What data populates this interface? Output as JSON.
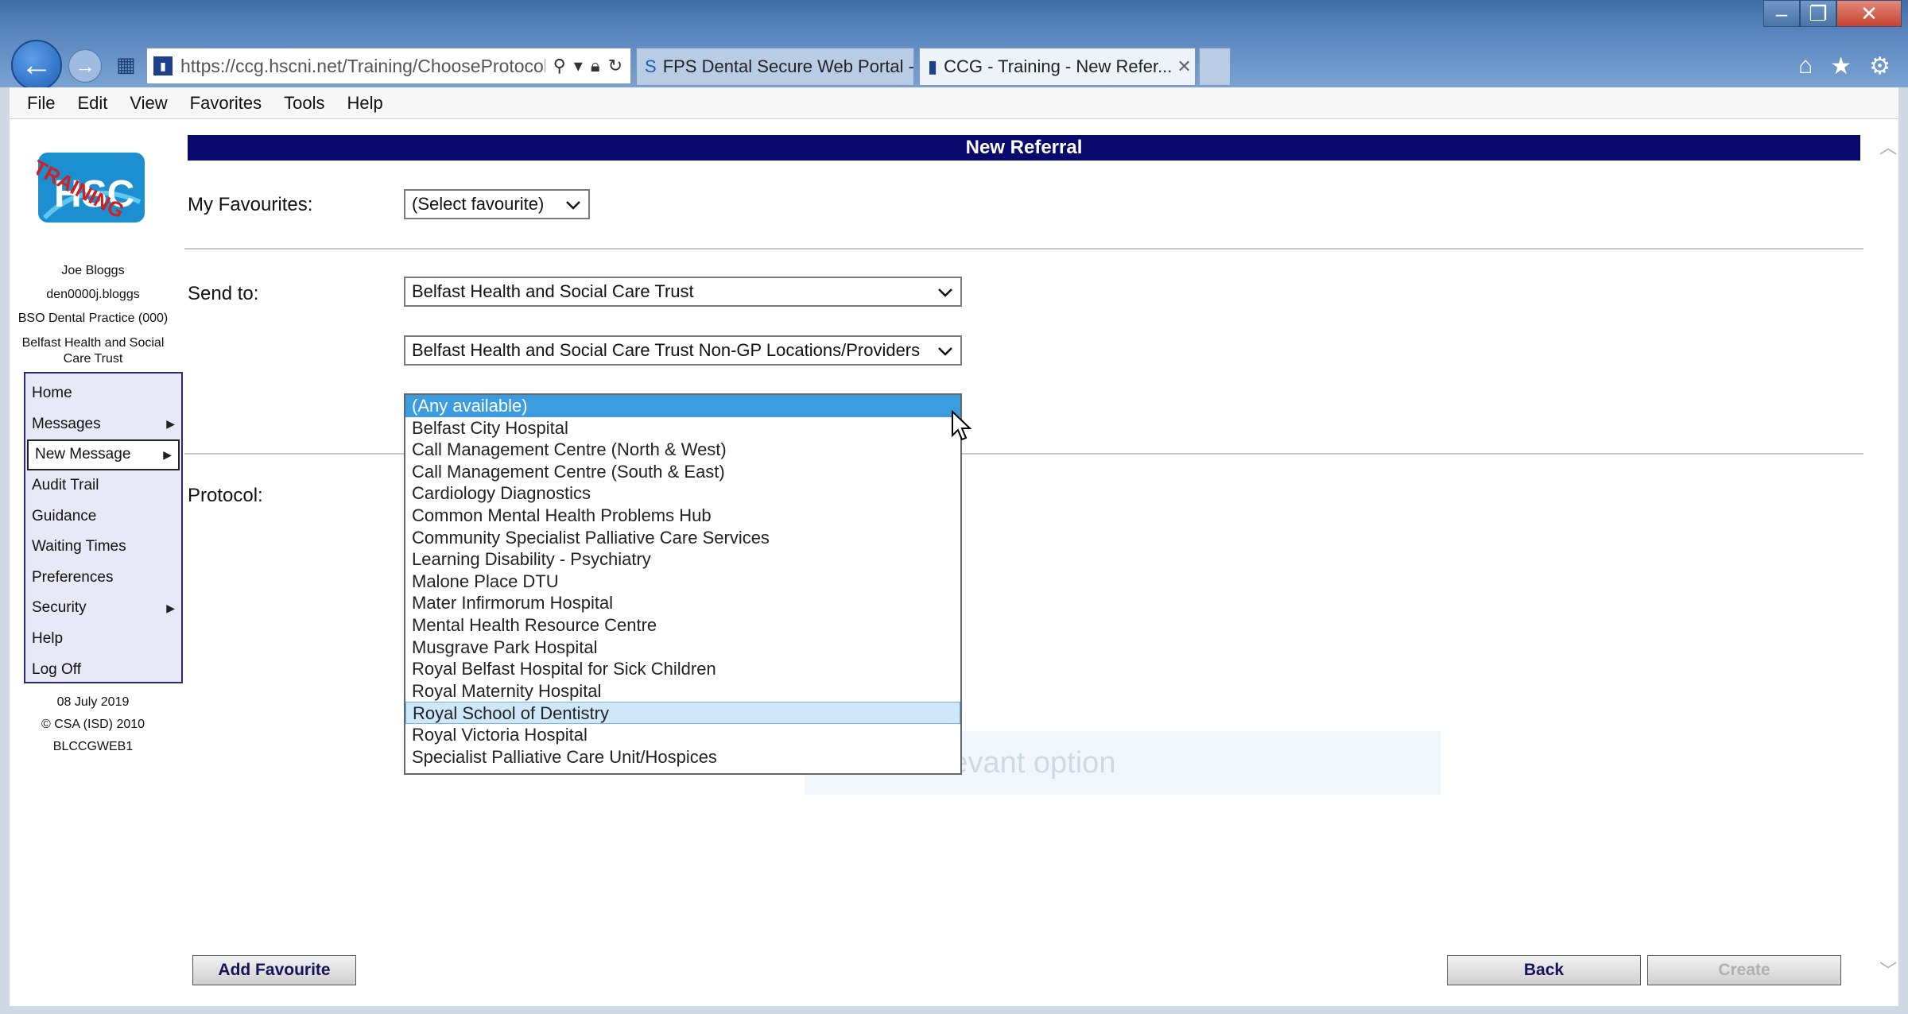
{
  "browser": {
    "address_url": "https://ccg.hscni.net/Training/ChooseProtocol",
    "tabs": [
      {
        "label": "FPS Dental Secure Web Portal -..."
      },
      {
        "label": "CCG - Training - New Refer..."
      }
    ],
    "menu": [
      "File",
      "Edit",
      "View",
      "Favorites",
      "Tools",
      "Help"
    ]
  },
  "sidebar": {
    "logo_text": "HSC",
    "logo_overlay": "TRAINING",
    "user_name": "Joe Bloggs",
    "user_id": "den0000j.bloggs",
    "practice": "BSO Dental Practice (000)",
    "trust": "Belfast Health and Social Care Trust",
    "menu": [
      {
        "label": "Home",
        "has_submenu": false
      },
      {
        "label": "Messages",
        "has_submenu": true
      },
      {
        "label": "New Message",
        "has_submenu": true
      },
      {
        "label": "Audit Trail",
        "has_submenu": false
      },
      {
        "label": "Guidance",
        "has_submenu": false
      },
      {
        "label": "Waiting Times",
        "has_submenu": false
      },
      {
        "label": "Preferences",
        "has_submenu": false
      },
      {
        "label": "Security",
        "has_submenu": true
      },
      {
        "label": "Help",
        "has_submenu": false
      },
      {
        "label": "Log Off",
        "has_submenu": false
      }
    ],
    "date": "08 July 2019",
    "copyright": "© CSA (ISD) 2010",
    "server": "BLCCGWEB1"
  },
  "form": {
    "title": "New Referral",
    "favourites_label": "My Favourites:",
    "favourites_value": "(Select favourite)",
    "send_to_label": "Send to:",
    "send_to_trust": "Belfast Health and Social Care Trust",
    "send_to_location": "Belfast Health and Social Care Trust Non-GP Locations/Providers",
    "protocol_label": "Protocol:",
    "provider_options": [
      "(Any available)",
      "Belfast City Hospital",
      "Call Management Centre (North & West)",
      "Call Management Centre (South & East)",
      "Cardiology Diagnostics",
      "Common Mental Health Problems Hub",
      "Community Specialist Palliative Care Services",
      "Learning Disability - Psychiatry",
      "Malone Place DTU",
      "Mater Infirmorum Hospital",
      "Mental Health Resource Centre",
      "Musgrave Park Hospital",
      "Royal Belfast Hospital for Sick Children",
      "Royal Maternity Hospital",
      "Royal School of Dentistry",
      "Royal Victoria Hospital",
      "Specialist Palliative Care Unit/Hospices"
    ],
    "selected_option": "(Any available)",
    "hovered_option": "Royal School of Dentistry",
    "hint_text": "Select relevant option",
    "add_favourite_label": "Add Favourite",
    "back_label": "Back",
    "create_label": "Create"
  }
}
